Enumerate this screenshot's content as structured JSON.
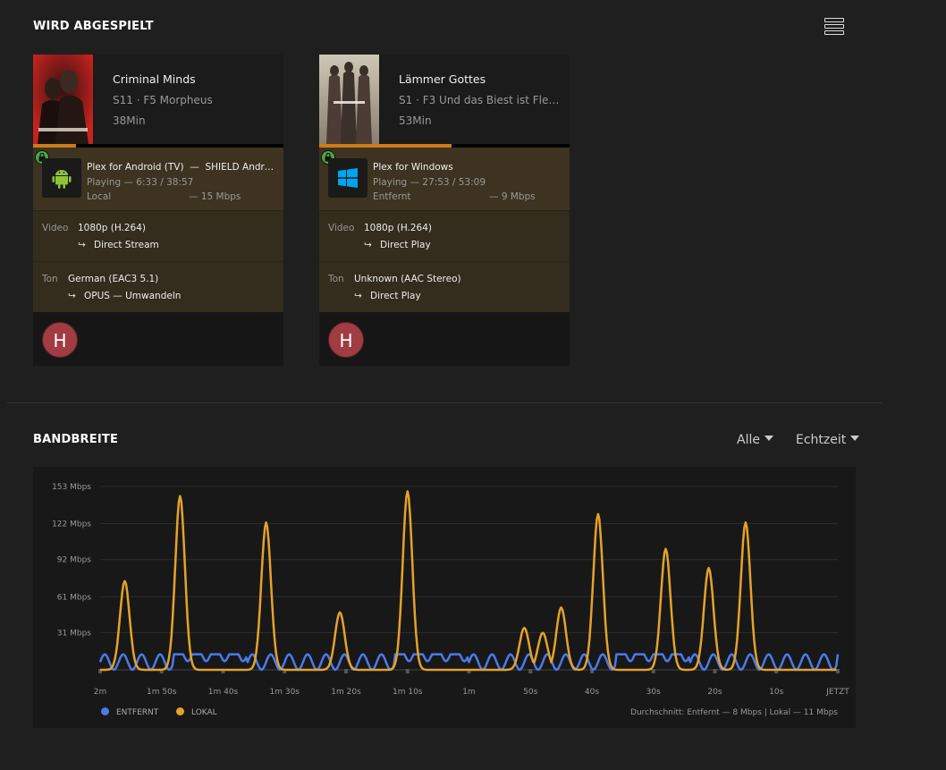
{
  "now_playing": {
    "title": "WIRD ABGESPIELT",
    "view_toggle_icon": "list-view-icon",
    "sessions": [
      {
        "title": "Criminal Minds",
        "subtitle": "S11 · F5 Morpheus",
        "duration": "38Min",
        "progress": 0.17,
        "player": {
          "name": "Plex for Android (TV)",
          "separator": "—",
          "device": "SHIELD Andro…",
          "state": "Playing — 6:33 / 38:57",
          "location": "Local",
          "bitrate": "— 15 Mbps",
          "icon": "android-icon",
          "secure_icon": "lock-icon"
        },
        "video": {
          "label": "Video",
          "value": "1080p (H.264)",
          "decision": "Direct Stream"
        },
        "audio": {
          "label": "Ton",
          "value": "German (EAC3 5.1)",
          "decision": "OPUS — Umwandeln"
        },
        "user_initial": "H"
      },
      {
        "title": "Lämmer Gottes",
        "subtitle": "S1 · F3 Und das Biest ist Fle…",
        "duration": "53Min",
        "progress": 0.53,
        "player": {
          "name": "Plex for Windows",
          "separator": "",
          "device": "",
          "state": "Playing — 27:53 / 53:09",
          "location": "Entfernt",
          "bitrate": "— 9 Mbps",
          "icon": "windows-icon",
          "secure_icon": "lock-icon"
        },
        "video": {
          "label": "Video",
          "value": "1080p (H.264)",
          "decision": "Direct Play"
        },
        "audio": {
          "label": "Ton",
          "value": "Unknown (AAC Stereo)",
          "decision": "Direct Play"
        },
        "user_initial": "H"
      }
    ]
  },
  "bandwidth": {
    "title": "BANDBREITE",
    "filter_label": "Alle",
    "range_label": "Echtzeit",
    "average_text": "Durchschnitt: Entfernt — 8 Mbps | Lokal — 11 Mbps"
  },
  "chart_data": {
    "type": "line",
    "title": "",
    "xlabel": "",
    "ylabel": "",
    "ylim": [
      0,
      153
    ],
    "y_ticks": [
      "153 Mbps",
      "122 Mbps",
      "92 Mbps",
      "61 Mbps",
      "31 Mbps"
    ],
    "y_tick_values": [
      153,
      122,
      92,
      61,
      31
    ],
    "x_ticks": [
      "2m",
      "1m 50s",
      "1m 40s",
      "1m 30s",
      "1m 20s",
      "1m 10s",
      "1m",
      "50s",
      "40s",
      "30s",
      "20s",
      "10s",
      "JETZT"
    ],
    "x_seconds": [
      -120,
      -110,
      -100,
      -90,
      -80,
      -70,
      -60,
      -50,
      -40,
      -30,
      -20,
      -10,
      0
    ],
    "grid": true,
    "legend_position": "bottom-left",
    "series": [
      {
        "name": "ENTFERNT",
        "color": "#4a7bea",
        "pattern": "oscillating",
        "values_low": 0,
        "values_high": 13
      },
      {
        "name": "LOKAL",
        "color": "#e5a229",
        "baseline": 0,
        "peaks": [
          {
            "t": -116,
            "value": 74
          },
          {
            "t": -107,
            "value": 145
          },
          {
            "t": -93,
            "value": 123
          },
          {
            "t": -81,
            "value": 48
          },
          {
            "t": -70,
            "value": 149
          },
          {
            "t": -51,
            "value": 35
          },
          {
            "t": -48,
            "value": 31
          },
          {
            "t": -45,
            "value": 52
          },
          {
            "t": -39,
            "value": 130
          },
          {
            "t": -28,
            "value": 101
          },
          {
            "t": -21,
            "value": 85
          },
          {
            "t": -15,
            "value": 123
          }
        ]
      }
    ]
  }
}
